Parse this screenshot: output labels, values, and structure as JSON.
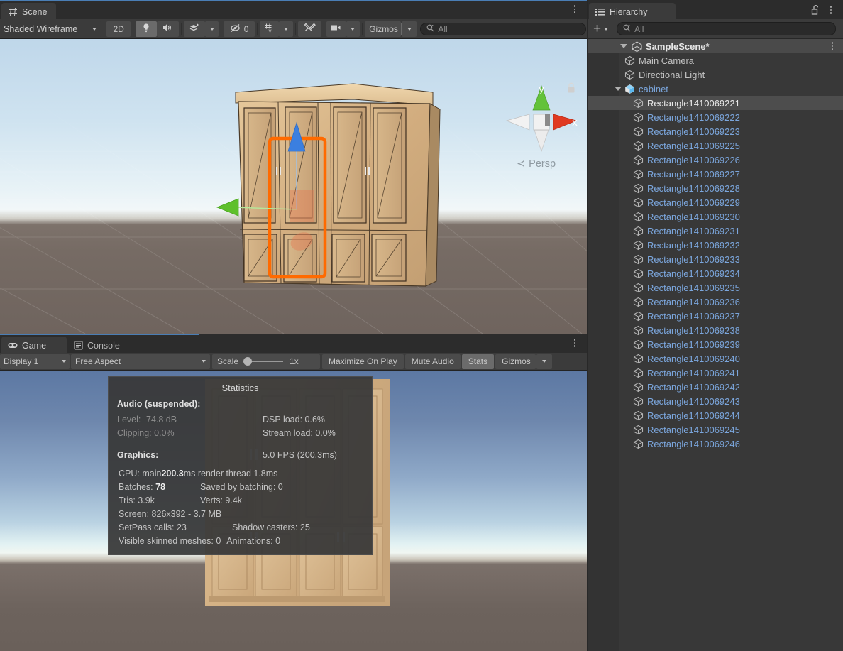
{
  "scene_panel": {
    "tab": {
      "label": "Scene",
      "icon": "grid-icon"
    },
    "toolbar": {
      "draw_mode": "Shaded Wireframe",
      "two_d": "2D",
      "lighting_icon": "lightbulb-icon",
      "audio_icon": "speaker-icon",
      "fx_icon": "effects-icon",
      "hidden_objects_count": "0",
      "hidden_icon": "eye-off-icon",
      "grid_icon": "grid-snap-icon",
      "tools_icon": "wrench-screwdriver-icon",
      "camera_icon": "camera-icon",
      "gizmos": "Gizmos",
      "search_placeholder": "All",
      "search_icon": "search-icon"
    },
    "overlay": {
      "axis_y": "y",
      "axis_x": "x",
      "persp_label": "Persp",
      "persp_arrow": "≺",
      "lock_icon": "lock-icon"
    }
  },
  "game_panel": {
    "tabs": [
      {
        "label": "Game",
        "icon": "gamepad-icon",
        "active": true
      },
      {
        "label": "Console",
        "icon": "console-icon",
        "active": false
      }
    ],
    "toolbar": {
      "display": "Display 1",
      "aspect": "Free Aspect",
      "scale_label": "Scale",
      "scale_value": "1x",
      "maximize_on_play": "Maximize On Play",
      "mute_audio": "Mute Audio",
      "stats": "Stats",
      "gizmos": "Gizmos"
    }
  },
  "statistics": {
    "title": "Statistics",
    "audio_header": "Audio (suspended):",
    "audio_rows": [
      {
        "left": "Level: -74.8 dB",
        "right": "DSP load: 0.6%"
      },
      {
        "left": "Clipping: 0.0%",
        "right": "Stream load: 0.0%"
      }
    ],
    "graphics_header": "Graphics:",
    "fps": "5.0 FPS (200.3ms)",
    "cpu_prefix": "CPU: main ",
    "cpu_main": "200.3",
    "cpu_suffix": "ms  render thread 1.8ms",
    "batches_label": "Batches: ",
    "batches_value": "78",
    "saved_by_batching": "Saved by batching: 0",
    "tris": "Tris: 3.9k",
    "verts": "Verts: 9.4k",
    "screen": "Screen: 826x392 - 3.7 MB",
    "setpass": "SetPass calls: 23",
    "shadow_casters": "Shadow casters: 25",
    "skinned_meshes": "Visible skinned meshes: 0",
    "animations": "Animations: 0"
  },
  "hierarchy": {
    "tab": {
      "label": "Hierarchy",
      "icon": "hierarchy-icon"
    },
    "lock_icon": "unlock-icon",
    "add_label": "+",
    "search_placeholder": "All",
    "search_icon": "search-icon",
    "scene": {
      "name": "SampleScene*",
      "icon": "unity-scene-icon"
    },
    "items": [
      {
        "name": "Main Camera",
        "depth": 2,
        "kind": "gameobject",
        "selected": false
      },
      {
        "name": "Directional Light",
        "depth": 2,
        "kind": "gameobject",
        "selected": false
      },
      {
        "name": "cabinet",
        "depth": 2,
        "kind": "prefab",
        "selected": false,
        "expanded": true
      },
      {
        "name": "Rectangle1410069221",
        "depth": 3,
        "kind": "gameobject",
        "selected": true
      },
      {
        "name": "Rectangle1410069222",
        "depth": 3,
        "kind": "prefab-child",
        "selected": false
      },
      {
        "name": "Rectangle1410069223",
        "depth": 3,
        "kind": "prefab-child",
        "selected": false
      },
      {
        "name": "Rectangle1410069225",
        "depth": 3,
        "kind": "prefab-child",
        "selected": false
      },
      {
        "name": "Rectangle1410069226",
        "depth": 3,
        "kind": "prefab-child",
        "selected": false
      },
      {
        "name": "Rectangle1410069227",
        "depth": 3,
        "kind": "prefab-child",
        "selected": false
      },
      {
        "name": "Rectangle1410069228",
        "depth": 3,
        "kind": "prefab-child",
        "selected": false
      },
      {
        "name": "Rectangle1410069229",
        "depth": 3,
        "kind": "prefab-child",
        "selected": false
      },
      {
        "name": "Rectangle1410069230",
        "depth": 3,
        "kind": "prefab-child",
        "selected": false
      },
      {
        "name": "Rectangle1410069231",
        "depth": 3,
        "kind": "prefab-child",
        "selected": false
      },
      {
        "name": "Rectangle1410069232",
        "depth": 3,
        "kind": "prefab-child",
        "selected": false
      },
      {
        "name": "Rectangle1410069233",
        "depth": 3,
        "kind": "prefab-child",
        "selected": false
      },
      {
        "name": "Rectangle1410069234",
        "depth": 3,
        "kind": "prefab-child",
        "selected": false
      },
      {
        "name": "Rectangle1410069235",
        "depth": 3,
        "kind": "prefab-child",
        "selected": false
      },
      {
        "name": "Rectangle1410069236",
        "depth": 3,
        "kind": "prefab-child",
        "selected": false
      },
      {
        "name": "Rectangle1410069237",
        "depth": 3,
        "kind": "prefab-child",
        "selected": false
      },
      {
        "name": "Rectangle1410069238",
        "depth": 3,
        "kind": "prefab-child",
        "selected": false
      },
      {
        "name": "Rectangle1410069239",
        "depth": 3,
        "kind": "prefab-child",
        "selected": false
      },
      {
        "name": "Rectangle1410069240",
        "depth": 3,
        "kind": "prefab-child",
        "selected": false
      },
      {
        "name": "Rectangle1410069241",
        "depth": 3,
        "kind": "prefab-child",
        "selected": false
      },
      {
        "name": "Rectangle1410069242",
        "depth": 3,
        "kind": "prefab-child",
        "selected": false
      },
      {
        "name": "Rectangle1410069243",
        "depth": 3,
        "kind": "prefab-child",
        "selected": false
      },
      {
        "name": "Rectangle1410069244",
        "depth": 3,
        "kind": "prefab-child",
        "selected": false
      },
      {
        "name": "Rectangle1410069245",
        "depth": 3,
        "kind": "prefab-child",
        "selected": false
      },
      {
        "name": "Rectangle1410069246",
        "depth": 3,
        "kind": "prefab-child",
        "selected": false
      }
    ]
  },
  "colors": {
    "panel_bg": "#383838",
    "toolbar_bg": "#3b3b3b",
    "tab_active": "#3b3b3b",
    "tab_strip": "#2c2c2c",
    "accent_blue": "#4a7eb5",
    "link_blue": "#7ba6dd",
    "selection": "#4d4d4d",
    "selection_outline": "#ff6a00",
    "axis_x": "#d8382a",
    "axis_y": "#5ec02c",
    "axis_z": "#3b7fe0",
    "wood": "#cdac7e"
  }
}
